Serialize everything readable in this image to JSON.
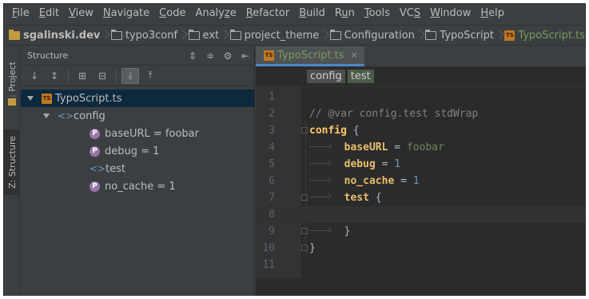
{
  "menu": [
    {
      "pre": "",
      "mn": "F",
      "post": "ile"
    },
    {
      "pre": "",
      "mn": "E",
      "post": "dit"
    },
    {
      "pre": "",
      "mn": "V",
      "post": "iew"
    },
    {
      "pre": "",
      "mn": "N",
      "post": "avigate"
    },
    {
      "pre": "",
      "mn": "C",
      "post": "ode"
    },
    {
      "pre": "Analy",
      "mn": "z",
      "post": "e"
    },
    {
      "pre": "",
      "mn": "R",
      "post": "efactor"
    },
    {
      "pre": "",
      "mn": "B",
      "post": "uild"
    },
    {
      "pre": "R",
      "mn": "u",
      "post": "n"
    },
    {
      "pre": "",
      "mn": "T",
      "post": "ools"
    },
    {
      "pre": "VC",
      "mn": "S",
      "post": ""
    },
    {
      "pre": "",
      "mn": "W",
      "post": "indow"
    },
    {
      "pre": "",
      "mn": "H",
      "post": "elp"
    }
  ],
  "navbar": {
    "crumbs": [
      "sgalinski.dev",
      "typo3conf",
      "ext",
      "project_theme",
      "Configuration",
      "TypoScript",
      "TypoScript.ts"
    ]
  },
  "toolstrip": {
    "project_tab": "1: Project",
    "structure_tab": "Z: Structure"
  },
  "structure": {
    "title": "Structure",
    "root": "TypoScript.ts",
    "config_node": "config",
    "items": [
      {
        "label": "baseURL = foobar",
        "kind": "property",
        "badge": "P"
      },
      {
        "label": "debug = 1",
        "kind": "property",
        "badge": "P"
      },
      {
        "label": "test",
        "kind": "block"
      },
      {
        "label": "no_cache = 1",
        "kind": "property",
        "badge": "P"
      }
    ]
  },
  "editor": {
    "tab_label": "TypoScript.ts",
    "tab_icon": "TS",
    "breadcrumbs": [
      "config",
      "test"
    ],
    "line_numbers": [
      "1",
      "2",
      "3",
      "4",
      "5",
      "6",
      "7",
      "8",
      "9",
      "10",
      "11"
    ],
    "lines": {
      "l2_comment": "// @var config.test stdWrap",
      "l3_key": "config",
      "l3_brace": " {",
      "l4_key": "baseURL",
      "l4_op": " = ",
      "l4_val": "foobar",
      "l5_key": "debug",
      "l5_op": " = ",
      "l5_val": "1",
      "l6_key": "no_cache",
      "l6_op": " = ",
      "l6_val": "1",
      "l7_key": "test",
      "l7_brace": " {",
      "l9_brace": "}",
      "l10_brace": "}"
    }
  },
  "colors": {
    "background": "#2b2b2b",
    "panel": "#3c3f41",
    "selection": "#0d293e",
    "active_file": "#7a9a5c"
  }
}
